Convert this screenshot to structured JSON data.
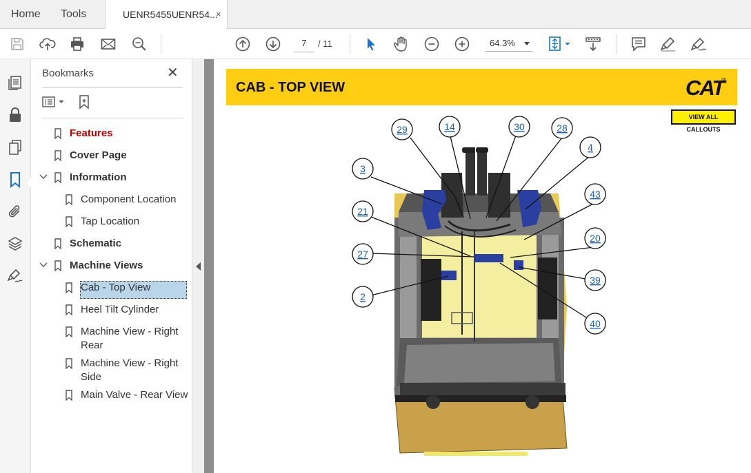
{
  "tabs": {
    "home": "Home",
    "tools": "Tools",
    "document": "UENR5455UENR54...",
    "close_symbol": "×"
  },
  "toolbar": {
    "page_current": "7",
    "page_total": "/ 11",
    "zoom": "64.3%",
    "icons": [
      "save-icon",
      "cloud-upload-icon",
      "print-icon",
      "email-icon",
      "search-zoom-icon",
      "prev-page-icon",
      "next-page-icon",
      "select-cursor-icon",
      "hand-icon",
      "zoom-out-icon",
      "zoom-in-icon",
      "fit-page-icon",
      "scroll-mode-icon",
      "comment-icon",
      "highlight-icon",
      "sign-icon"
    ]
  },
  "left_rail": {
    "icons": [
      "page-thumbnails-icon",
      "lock-icon",
      "copy-pages-icon",
      "bookmark-icon",
      "attachment-icon",
      "layers-icon",
      "signature-icon"
    ],
    "active": "bookmark-icon"
  },
  "bookmarks": {
    "title": "Bookmarks",
    "close_symbol": "✕",
    "items": [
      {
        "label": "Features",
        "level": 0,
        "style": "red"
      },
      {
        "label": "Cover Page",
        "level": 0,
        "style": "bold"
      },
      {
        "label": "Information",
        "level": 0,
        "style": "bold",
        "expanded": true
      },
      {
        "label": "Component Location",
        "level": 1,
        "style": "normal"
      },
      {
        "label": "Tap Location",
        "level": 1,
        "style": "normal"
      },
      {
        "label": "Schematic",
        "level": 0,
        "style": "bold"
      },
      {
        "label": "Machine Views",
        "level": 0,
        "style": "bold",
        "expanded": true
      },
      {
        "label": "Cab - Top View",
        "level": 1,
        "style": "normal",
        "selected": true
      },
      {
        "label": "Heel Tilt Cylinder",
        "level": 1,
        "style": "normal"
      },
      {
        "label": "Machine View - Right Rear",
        "level": 1,
        "style": "normal"
      },
      {
        "label": "Machine View - Right Side",
        "level": 1,
        "style": "normal"
      },
      {
        "label": "Main Valve - Rear View",
        "level": 1,
        "style": "normal"
      }
    ]
  },
  "document": {
    "banner_title": "CAB - TOP VIEW",
    "logo_text": "CAT",
    "logo_reg": "®",
    "view_all_button": "VIEW ALL CALLOUTS",
    "callouts": [
      "29",
      "14",
      "30",
      "28",
      "4",
      "3",
      "43",
      "21",
      "20",
      "27",
      "39",
      "2",
      "40"
    ],
    "colors": {
      "banner": "#ffcd11",
      "callout_link": "#1a5fb4",
      "button": "#ffef00"
    }
  }
}
